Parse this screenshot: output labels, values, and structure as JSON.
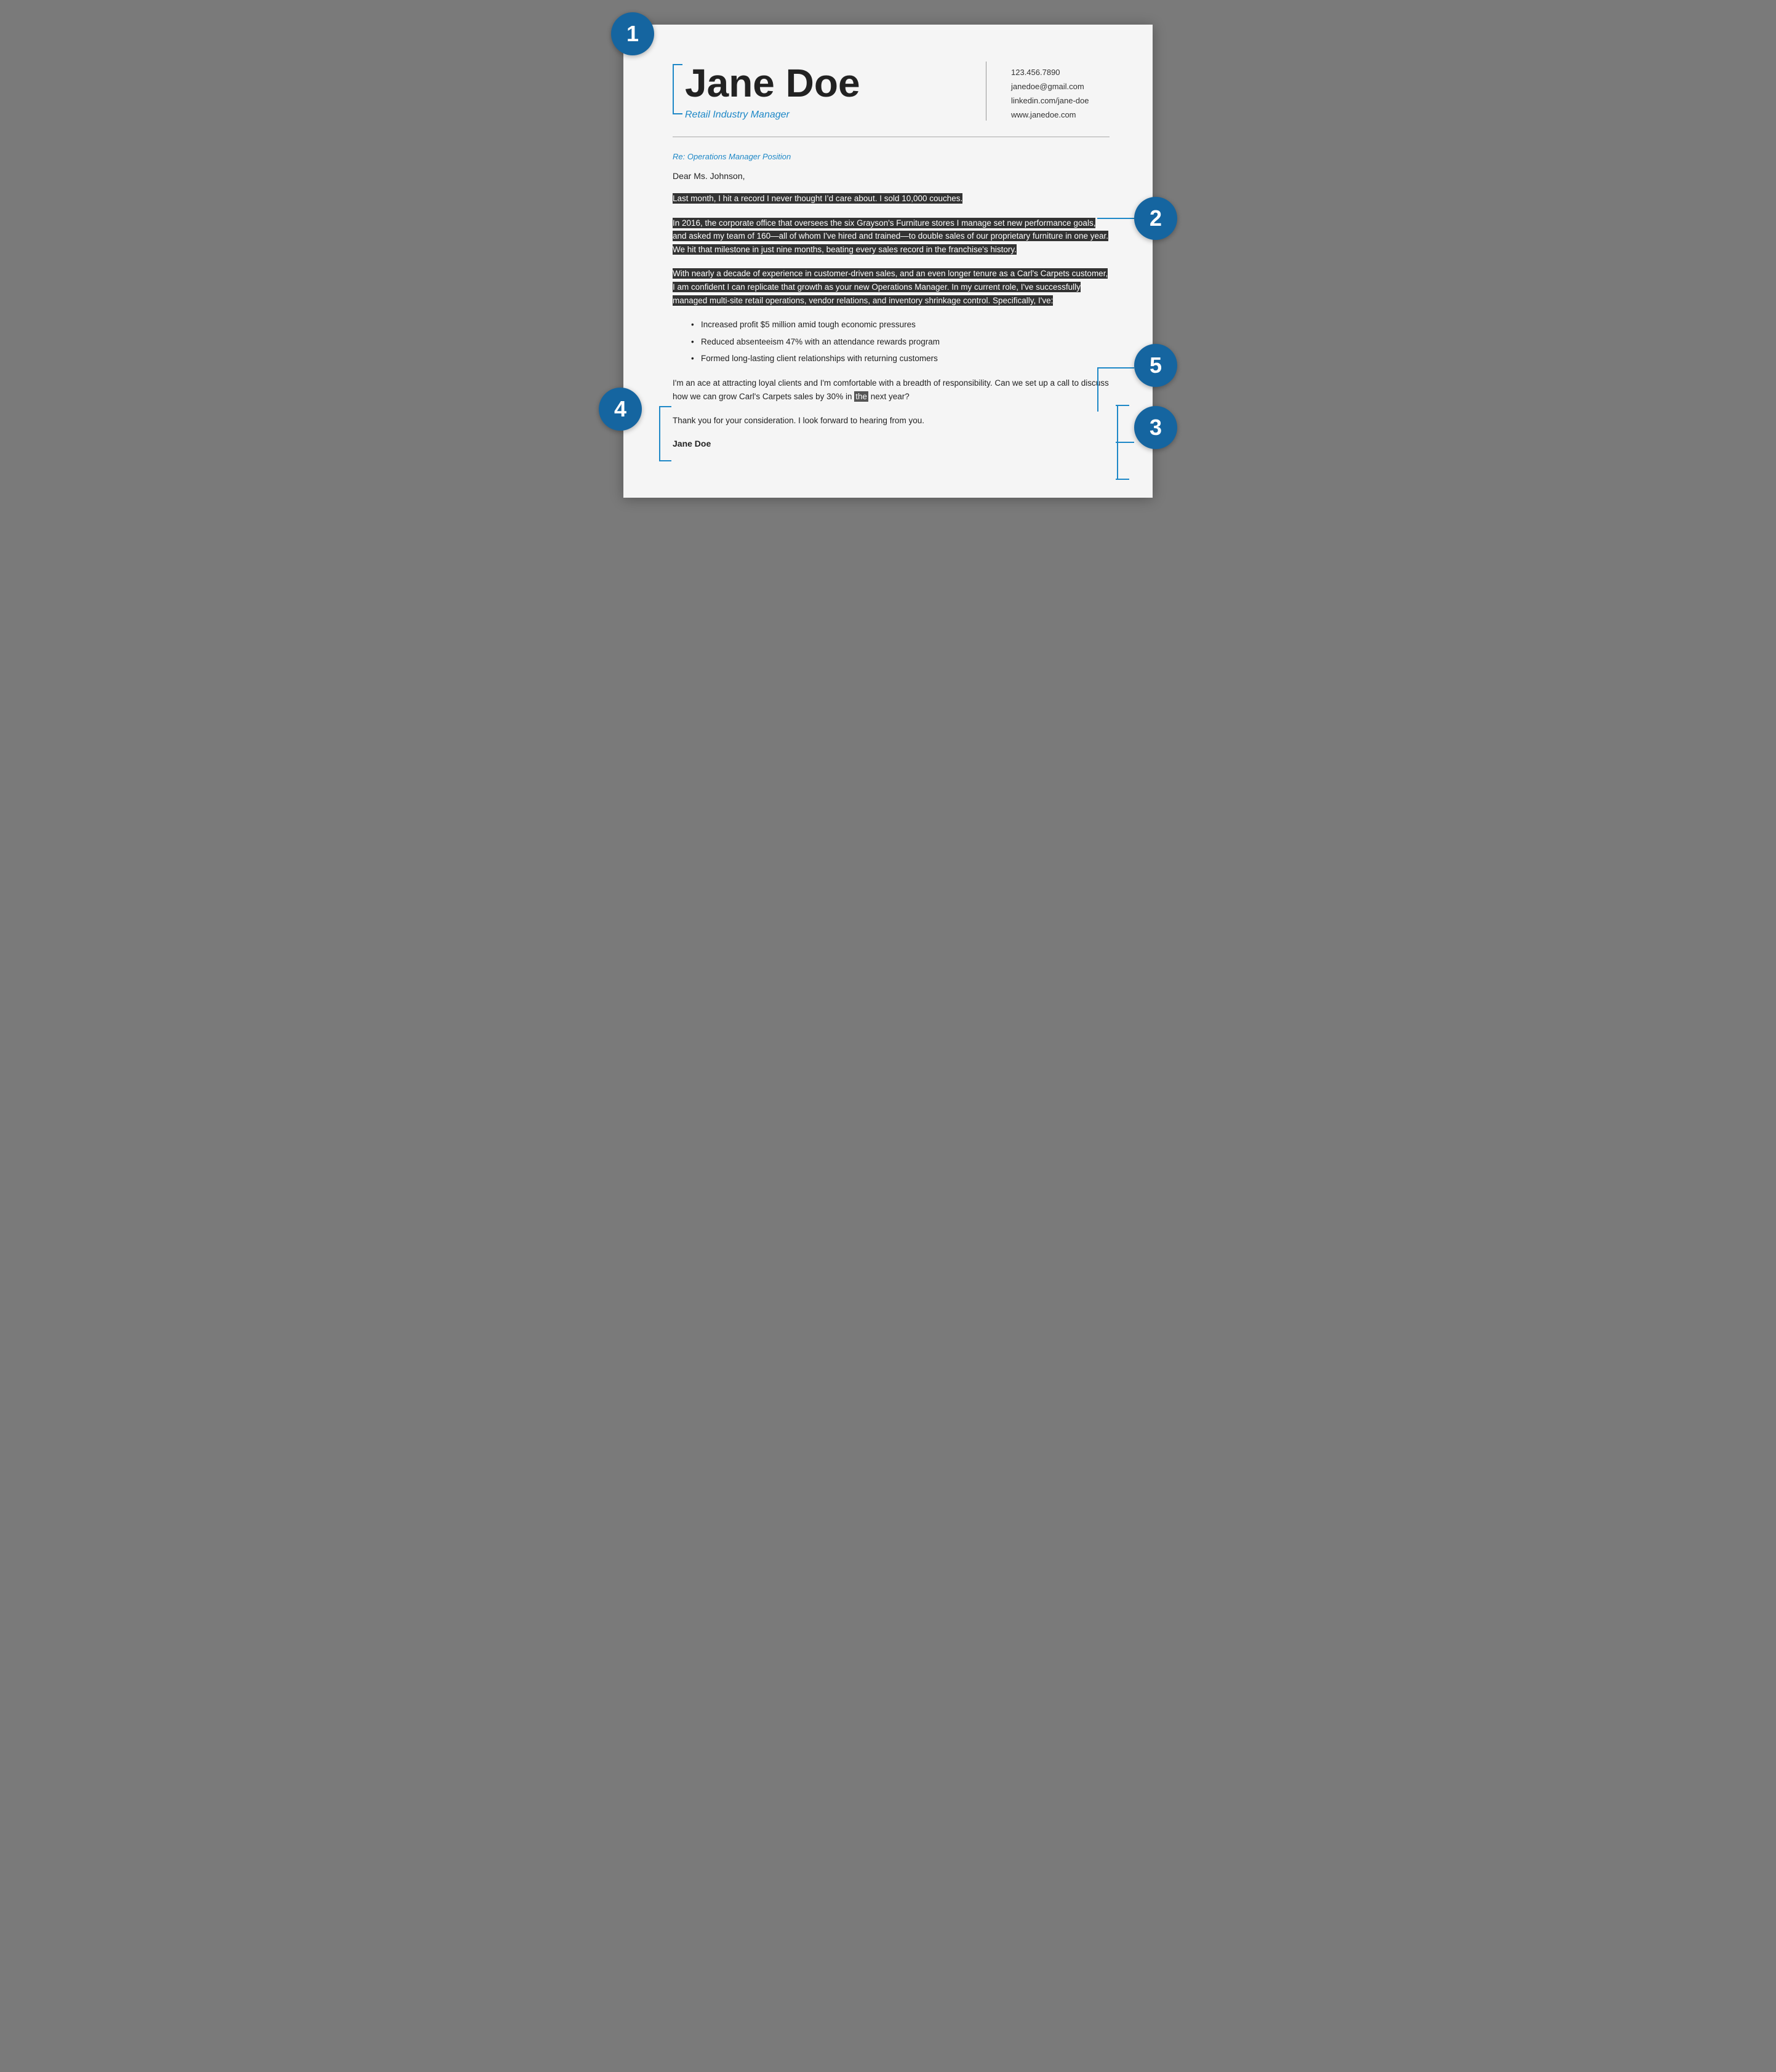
{
  "header": {
    "name": "Jane Doe",
    "title": "Retail Industry Manager",
    "contact": {
      "phone": "123.456.7890",
      "email": "janedoe@gmail.com",
      "linkedin": "linkedin.com/jane-doe",
      "website": "www.janedoe.com"
    }
  },
  "letter": {
    "subject": "Re: Operations Manager Position",
    "salutation": "Dear Ms. Johnson,",
    "paragraph1": "Last month, I hit a record I never thought I’d care about. I sold 10,000 couches.",
    "paragraph2": "In 2016, the corporate office that oversees the six Grayson’s Furniture stores I manage set new performance goals, and asked my team of 160—all of whom I’ve hired and trained—to double sales of our proprietary furniture in one year. We hit that milestone in just nine months, beating every sales record in the franchise’s history.",
    "paragraph3": "With nearly a decade of experience in customer-driven sales, and an even longer tenure as a Carl’s Carpets customer, I am confident I can replicate that growth as your new Operations Manager. In my current role, I’ve successfully managed multi-site retail operations, vendor relations, and inventory shrinkage control. Specifically, I’ve:",
    "bullets": [
      "Increased profit $5 million amid tough economic pressures",
      "Reduced absenteeism 47% with an attendance rewards program",
      "Formed long-lasting client relationships with returning customers"
    ],
    "paragraph4": "I’m an ace at attracting loyal clients and I’m comfortable with a breadth of responsibility. Can we set up a call to discuss how we can grow Carl’s Carpets sales by 30% in the next year?",
    "paragraph5": "Thank you for your consideration. I look forward to hearing from you.",
    "signature": "Jane Doe"
  },
  "annotations": {
    "bubble1": "1",
    "bubble2": "2",
    "bubble3": "3",
    "bubble4": "4",
    "bubble5": "5"
  }
}
